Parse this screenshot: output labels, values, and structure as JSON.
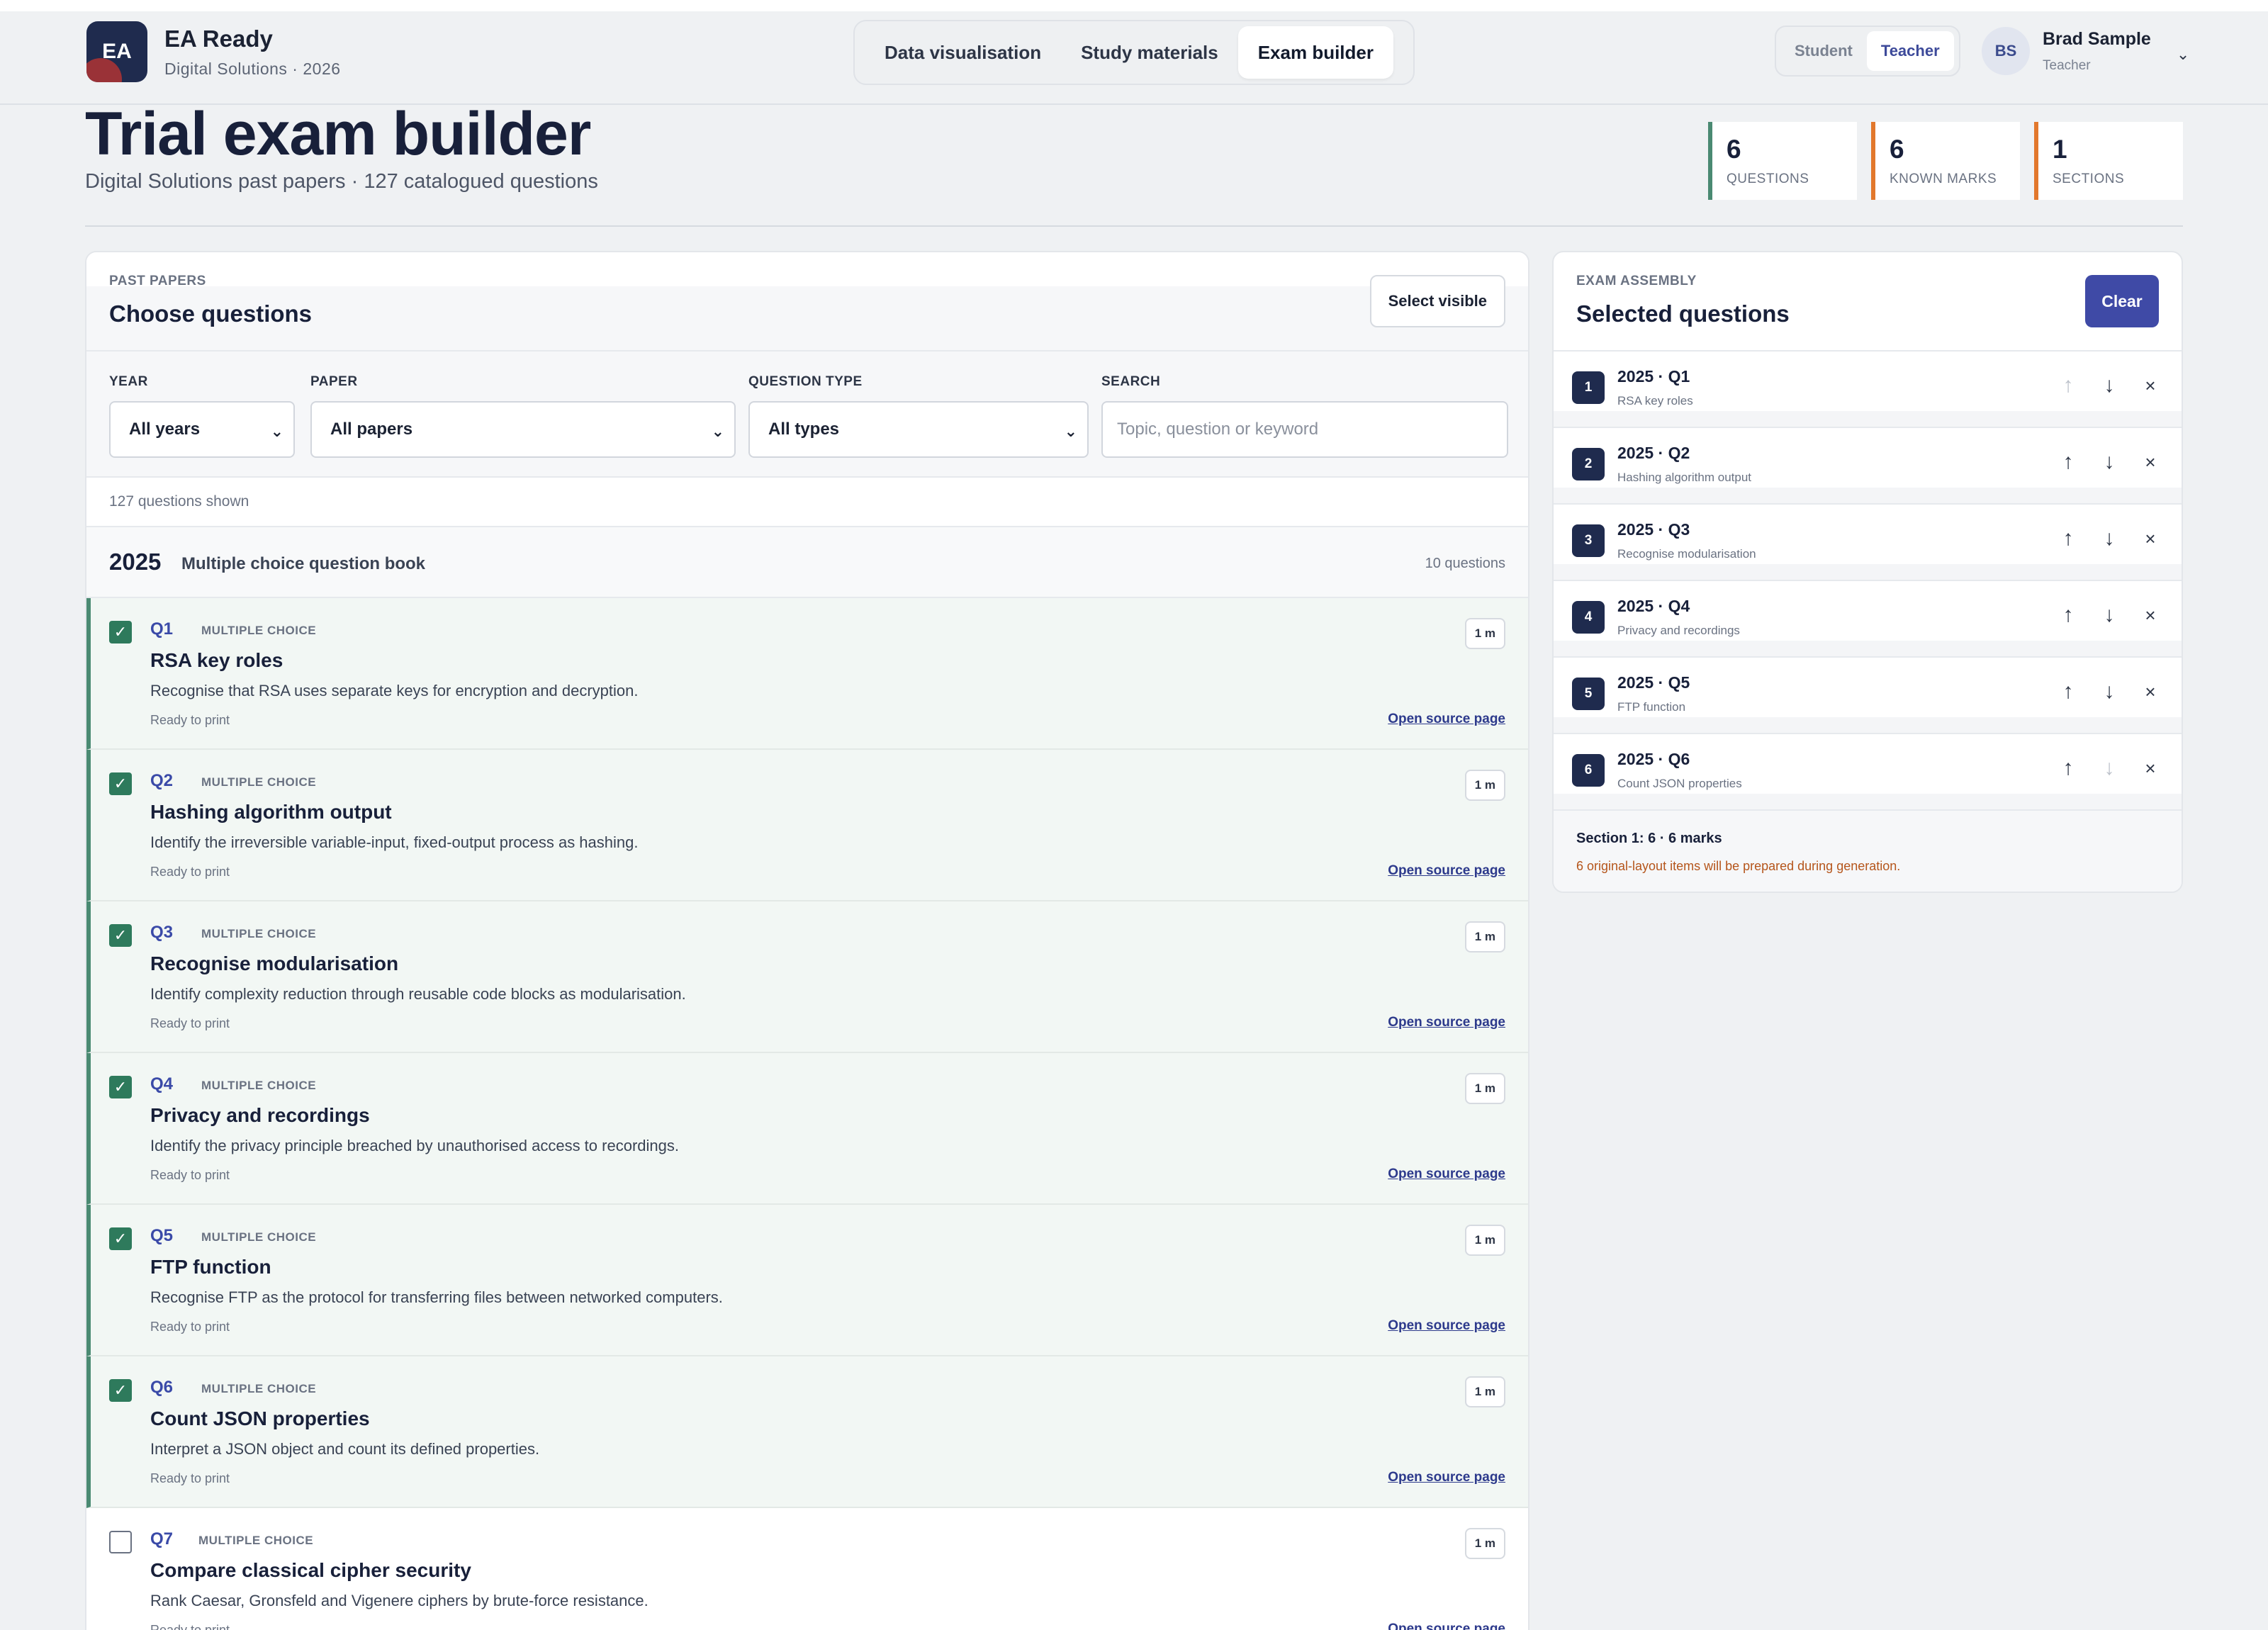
{
  "app": {
    "logo_text": "EA",
    "title": "EA Ready",
    "subtitle": "Digital Solutions · 2026"
  },
  "nav": {
    "tabs": [
      {
        "label": "Data visualisation"
      },
      {
        "label": "Study materials"
      },
      {
        "label": "Exam builder",
        "active": true
      }
    ]
  },
  "roles": {
    "student": "Student",
    "teacher": "Teacher",
    "active": "Teacher"
  },
  "user": {
    "initials": "BS",
    "name": "Brad Sample",
    "role": "Teacher"
  },
  "page": {
    "title": "Trial exam builder",
    "subtitle": "Digital Solutions past papers · 127 catalogued questions"
  },
  "stats": [
    {
      "value": "6",
      "label": "QUESTIONS",
      "color": "#4a8a72"
    },
    {
      "value": "6",
      "label": "KNOWN MARKS",
      "color": "#e2782c"
    },
    {
      "value": "1",
      "label": "SECTIONS",
      "color": "#e2782c"
    }
  ],
  "left": {
    "eyebrow": "PAST PAPERS",
    "title": "Choose questions",
    "select_visible": "Select visible",
    "filters": {
      "year_label": "YEAR",
      "year_value": "All years",
      "paper_label": "PAPER",
      "paper_value": "All papers",
      "type_label": "QUESTION TYPE",
      "type_value": "All types",
      "search_label": "SEARCH",
      "search_placeholder": "Topic, question or keyword"
    },
    "count_text": "127 questions shown",
    "group": {
      "year": "2025",
      "name": "Multiple choice question book",
      "count": "10 questions"
    },
    "questions": [
      {
        "num": "Q1",
        "type": "MULTIPLE CHOICE",
        "title": "RSA key roles",
        "desc": "Recognise that RSA uses separate keys for encryption and decryption.",
        "status": "Ready to print",
        "marks": "1 m",
        "link": "Open source page",
        "selected": true
      },
      {
        "num": "Q2",
        "type": "MULTIPLE CHOICE",
        "title": "Hashing algorithm output",
        "desc": "Identify the irreversible variable-input, fixed-output process as hashing.",
        "status": "Ready to print",
        "marks": "1 m",
        "link": "Open source page",
        "selected": true
      },
      {
        "num": "Q3",
        "type": "MULTIPLE CHOICE",
        "title": "Recognise modularisation",
        "desc": "Identify complexity reduction through reusable code blocks as modularisation.",
        "status": "Ready to print",
        "marks": "1 m",
        "link": "Open source page",
        "selected": true
      },
      {
        "num": "Q4",
        "type": "MULTIPLE CHOICE",
        "title": "Privacy and recordings",
        "desc": "Identify the privacy principle breached by unauthorised access to recordings.",
        "status": "Ready to print",
        "marks": "1 m",
        "link": "Open source page",
        "selected": true
      },
      {
        "num": "Q5",
        "type": "MULTIPLE CHOICE",
        "title": "FTP function",
        "desc": "Recognise FTP as the protocol for transferring files between networked computers.",
        "status": "Ready to print",
        "marks": "1 m",
        "link": "Open source page",
        "selected": true
      },
      {
        "num": "Q6",
        "type": "MULTIPLE CHOICE",
        "title": "Count JSON properties",
        "desc": "Interpret a JSON object and count its defined properties.",
        "status": "Ready to print",
        "marks": "1 m",
        "link": "Open source page",
        "selected": true
      },
      {
        "num": "Q7",
        "type": "MULTIPLE CHOICE",
        "title": "Compare classical cipher security",
        "desc": "Rank Caesar, Gronsfeld and Vigenere ciphers by brute-force resistance.",
        "status": "Ready to print",
        "marks": "1 m",
        "link": "Open source page",
        "selected": false
      }
    ]
  },
  "right": {
    "eyebrow": "EXAM ASSEMBLY",
    "title": "Selected questions",
    "clear": "Clear",
    "items": [
      {
        "idx": "1",
        "title": "2025 · Q1",
        "sub": "RSA key roles",
        "up_disabled": true,
        "down_disabled": false
      },
      {
        "idx": "2",
        "title": "2025 · Q2",
        "sub": "Hashing algorithm output",
        "up_disabled": false,
        "down_disabled": false
      },
      {
        "idx": "3",
        "title": "2025 · Q3",
        "sub": "Recognise modularisation",
        "up_disabled": false,
        "down_disabled": false
      },
      {
        "idx": "4",
        "title": "2025 · Q4",
        "sub": "Privacy and recordings",
        "up_disabled": false,
        "down_disabled": false
      },
      {
        "idx": "5",
        "title": "2025 · Q5",
        "sub": "FTP function",
        "up_disabled": false,
        "down_disabled": false
      },
      {
        "idx": "6",
        "title": "2025 · Q6",
        "sub": "Count JSON properties",
        "up_disabled": false,
        "down_disabled": true
      }
    ],
    "summary_title": "Section 1: 6 · 6 marks",
    "summary_note": "6 original-layout items will be prepared during generation."
  },
  "icons": {
    "check": "✓",
    "up": "↑",
    "down": "↓",
    "remove": "×",
    "chevron": "⌄"
  }
}
